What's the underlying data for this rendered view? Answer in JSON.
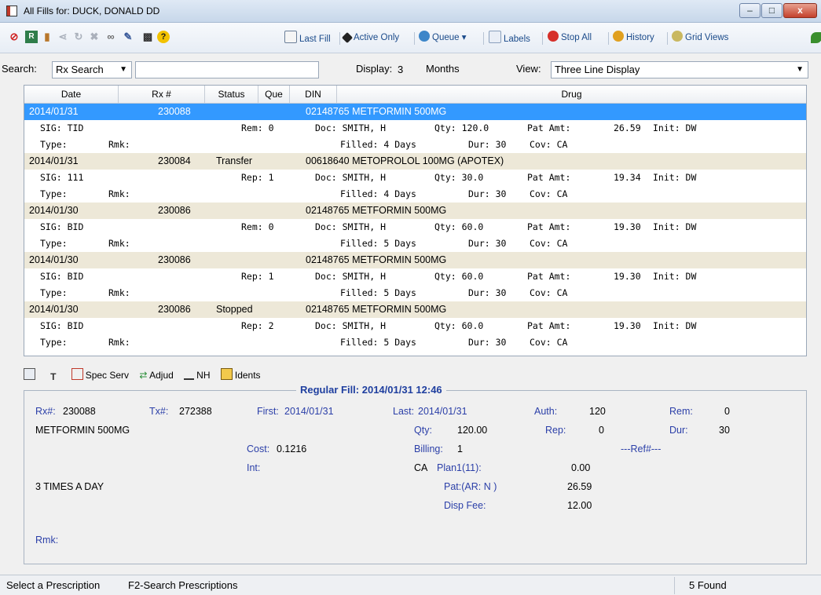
{
  "window": {
    "title": "All Fills for: DUCK, DONALD DD",
    "min": "–",
    "max": "□",
    "close": "x"
  },
  "toolbar": {
    "last_fill": "Last Fill",
    "active_only": "Active Only",
    "queue": "Queue",
    "labels": "Labels",
    "stop_all": "Stop All",
    "history": "History",
    "grid_views": "Grid Views"
  },
  "search": {
    "label": "Search:",
    "type": "Rx Search",
    "value": "",
    "display_label": "Display:",
    "display_value": "3",
    "months": "Months",
    "view_label": "View:",
    "view_value": "Three Line Display"
  },
  "grid": {
    "headers": [
      "Date",
      "Rx #",
      "Status",
      "Que",
      "DIN",
      "Drug"
    ],
    "records": [
      {
        "date": "2014/01/31",
        "rx": "230088",
        "status": "",
        "din_drug": "02148765 METFORMIN 500MG",
        "sig": "SIG: TID",
        "rem_rep": "Rem: 0",
        "doc": "Doc: SMITH, H",
        "qty": "Qty:   120.0",
        "pat_amt": "Pat Amt:",
        "amt": "26.59",
        "init": "Init: DW",
        "type": "Type:",
        "rmk": "Rmk:",
        "filled": "Filled:   4 Days",
        "dur": "Dur:   30",
        "cov": "Cov: CA"
      },
      {
        "date": "2014/01/31",
        "rx": "230084",
        "status": "Transfer",
        "din_drug": "00618640 METOPROLOL 100MG (APOTEX)",
        "sig": "SIG: 111",
        "rem_rep": "Rep: 1",
        "doc": "Doc: SMITH, H",
        "qty": "Qty:    30.0",
        "pat_amt": "Pat Amt:",
        "amt": "19.34",
        "init": "Init: DW",
        "type": "Type:",
        "rmk": "Rmk:",
        "filled": "Filled:   4 Days",
        "dur": "Dur:   30",
        "cov": "Cov: CA"
      },
      {
        "date": "2014/01/30",
        "rx": "230086",
        "status": "",
        "din_drug": "02148765 METFORMIN 500MG",
        "sig": "SIG: BID",
        "rem_rep": "Rem: 0",
        "doc": "Doc: SMITH, H",
        "qty": "Qty:    60.0",
        "pat_amt": "Pat Amt:",
        "amt": "19.30",
        "init": "Init: DW",
        "type": "Type:",
        "rmk": "Rmk:",
        "filled": "Filled:   5 Days",
        "dur": "Dur:   30",
        "cov": "Cov: CA"
      },
      {
        "date": "2014/01/30",
        "rx": "230086",
        "status": "",
        "din_drug": "02148765 METFORMIN 500MG",
        "sig": "SIG: BID",
        "rem_rep": "Rep: 1",
        "doc": "Doc: SMITH, H",
        "qty": "Qty:    60.0",
        "pat_amt": "Pat Amt:",
        "amt": "19.30",
        "init": "Init: DW",
        "type": "Type:",
        "rmk": "Rmk:",
        "filled": "Filled:   5 Days",
        "dur": "Dur:   30",
        "cov": "Cov: CA"
      },
      {
        "date": "2014/01/30",
        "rx": "230086",
        "status": "Stopped",
        "din_drug": "02148765 METFORMIN 500MG",
        "sig": "SIG: BID",
        "rem_rep": "Rep: 2",
        "doc": "Doc: SMITH, H",
        "qty": "Qty:    60.0",
        "pat_amt": "Pat Amt:",
        "amt": "19.30",
        "init": "Init: DW",
        "type": "Type:",
        "rmk": "Rmk:",
        "filled": "Filled:   5 Days",
        "dur": "Dur:   30",
        "cov": "Cov: CA"
      }
    ]
  },
  "detail_toolbar": {
    "spec_serv": "Spec Serv",
    "adjud": "Adjud",
    "nh": "NH",
    "idents": "Idents"
  },
  "detail": {
    "title": "Regular Fill: 2014/01/31   12:46",
    "rx_label": "Rx#:",
    "rx": "230088",
    "tx_label": "Tx#:",
    "tx": "272388",
    "first_label": "First:",
    "first": "2014/01/31",
    "last_label": "Last:",
    "last": "2014/01/31",
    "auth_label": "Auth:",
    "auth": "120",
    "rem_label": "Rem:",
    "rem": "0",
    "drug": "METFORMIN 500MG",
    "qty_label": "Qty:",
    "qty": "120.00",
    "rep_label": "Rep:",
    "rep": "0",
    "dur_label": "Dur:",
    "dur": "30",
    "cost_label": "Cost:",
    "cost": "0.1216",
    "billing_label": "Billing:",
    "billing": "1",
    "ref_label": "---Ref#---",
    "int_label": "Int:",
    "prov": "CA",
    "plan_label": "Plan1(11):",
    "plan": "0.00",
    "sig_text": "3 TIMES A DAY",
    "pat_label": "Pat:(AR: N )",
    "pat": "26.59",
    "disp_label": "Disp Fee:",
    "disp": "12.00",
    "rmk_label": "Rmk:"
  },
  "status": {
    "left1": "Select a Prescription",
    "left2": "F2-Search Prescriptions",
    "right": "5 Found"
  },
  "colors": {
    "selection": "#3399ff",
    "row_band": "#ede8d8",
    "label_blue": "#2b3fa8"
  }
}
